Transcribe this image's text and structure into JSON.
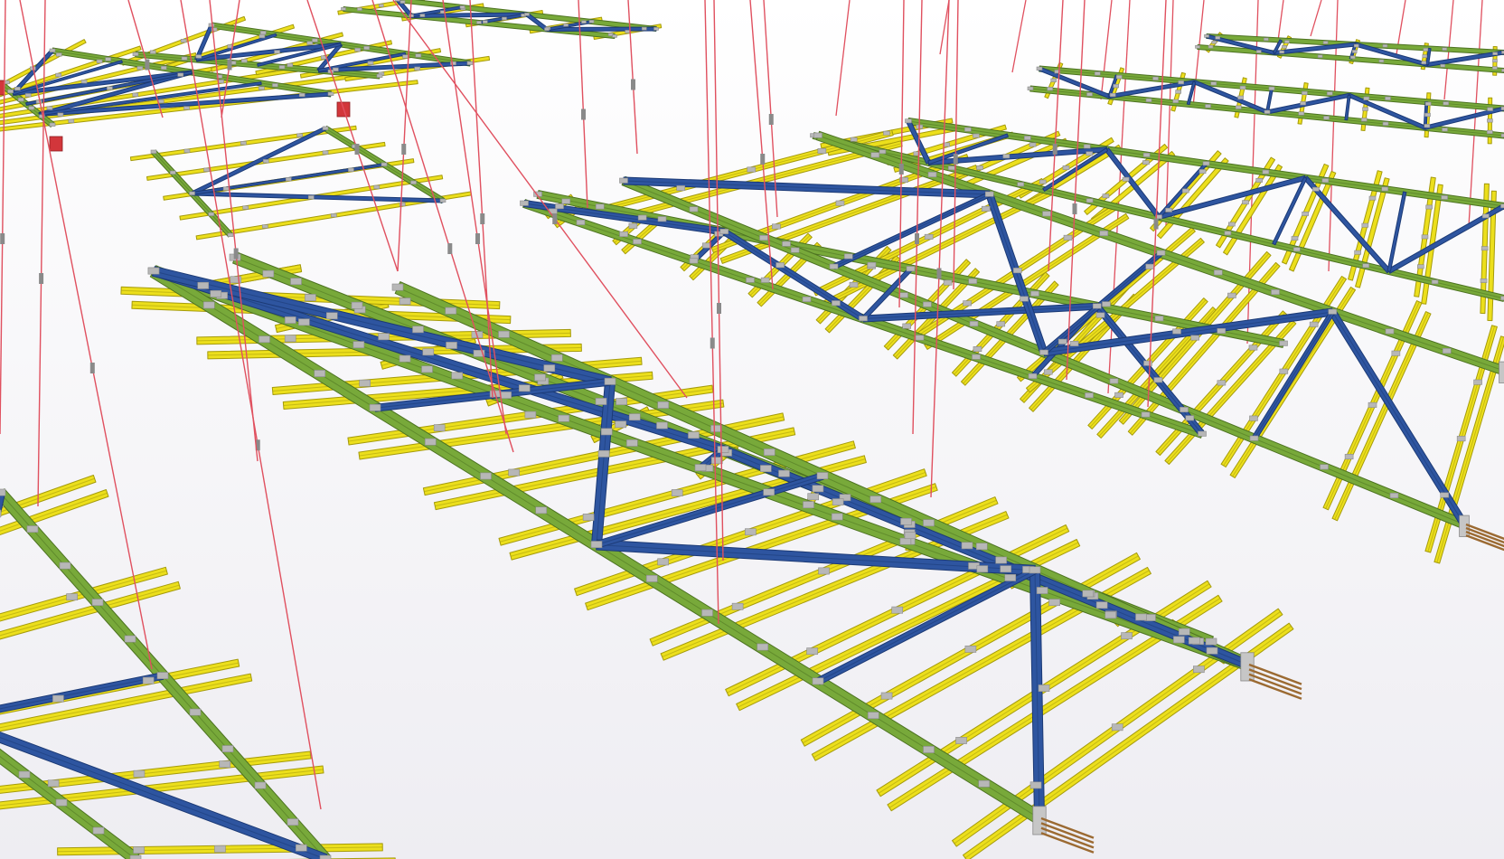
{
  "view": {
    "type": "3d-structural-model-viewport",
    "background_top": "#ffffff",
    "background_bottom": "#eeedf2"
  },
  "colors": {
    "main_girder": "#78a93a",
    "main_girder_edge": "#4d7321",
    "diagonal_brace": "#2e55a0",
    "diagonal_brace_edge": "#1c3a75",
    "secondary_beam": "#ecdf1c",
    "secondary_beam_edge": "#a59b0c",
    "connection_plate": "#b7b7b7",
    "hanger_rod": "#e0505f",
    "anchor_bolt": "#9b6a32",
    "support_block": "#d2363b"
  },
  "elements": {
    "girder_color_name": "green",
    "brace_color_name": "blue",
    "beam_color_name": "yellow",
    "hanger_color_name": "red",
    "plate_color_name": "grey"
  }
}
